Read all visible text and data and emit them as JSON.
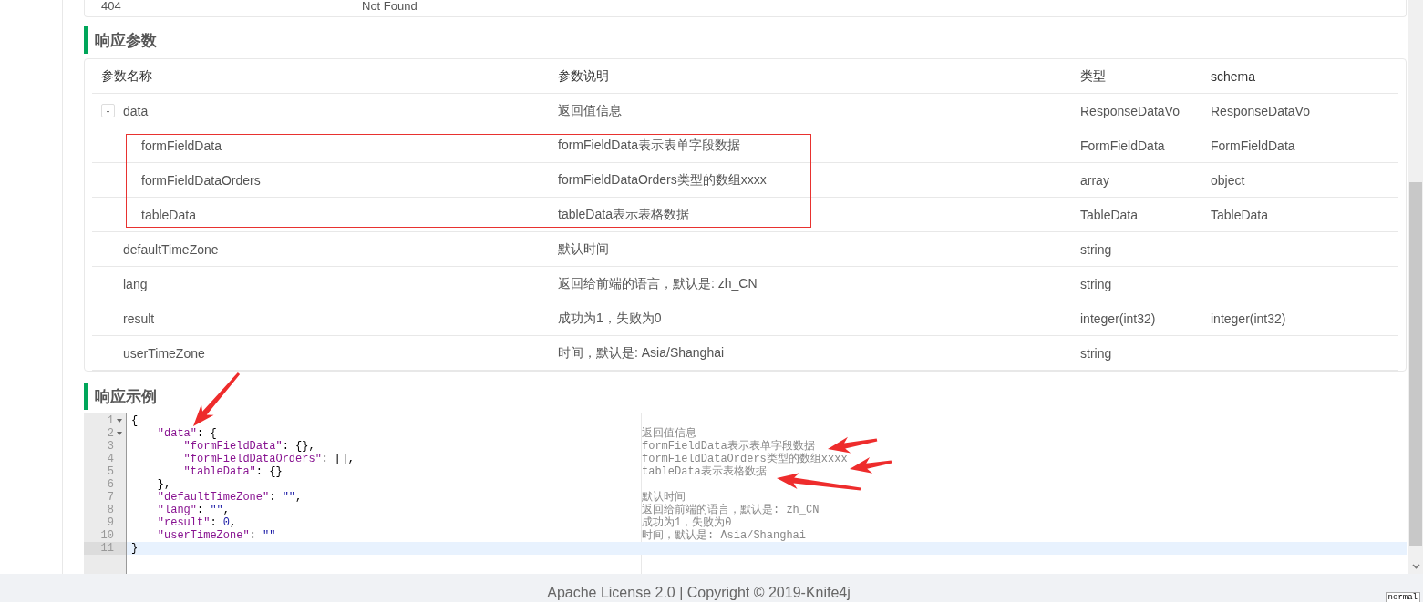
{
  "status_card": {
    "code": "404",
    "message": "Not Found"
  },
  "response_params": {
    "title": "响应参数",
    "columns": [
      "参数名称",
      "参数说明",
      "类型",
      "schema"
    ],
    "rows": [
      {
        "name": "data",
        "description": "返回值信息",
        "type": "ResponseDataVo",
        "schema": "ResponseDataVo",
        "toggle": "-",
        "expanded": true,
        "children": [
          {
            "name": "formFieldData",
            "description": "formFieldData表示表单字段数据",
            "type": "FormFieldData",
            "schema": "FormFieldData"
          },
          {
            "name": "formFieldDataOrders",
            "description": "formFieldDataOrders类型的数组xxxx",
            "type": "array",
            "schema": "object"
          },
          {
            "name": "tableData",
            "description": "tableData表示表格数据",
            "type": "TableData",
            "schema": "TableData"
          }
        ]
      },
      {
        "name": "defaultTimeZone",
        "description": "默认时间",
        "type": "string"
      },
      {
        "name": "lang",
        "description": "返回给前端的语言，默认是: zh_CN",
        "type": "string"
      },
      {
        "name": "result",
        "description": "成功为1，失败为0",
        "type": "integer(int32)",
        "schema": "integer(int32)"
      },
      {
        "name": "userTimeZone",
        "description": "时间，默认是: Asia/Shanghai",
        "type": "string"
      }
    ]
  },
  "response_example": {
    "title": "响应示例",
    "lines": [
      {
        "num": "1",
        "foldable": true,
        "current": false,
        "tokens": [
          {
            "kind": "punct",
            "text": "{"
          }
        ]
      },
      {
        "num": "2",
        "foldable": true,
        "current": false,
        "tokens": [
          {
            "kind": "key",
            "text": "    \"data\""
          },
          {
            "kind": "punct",
            "text": ": {"
          }
        ],
        "comment": "返回值信息"
      },
      {
        "num": "3",
        "foldable": false,
        "current": false,
        "tokens": [
          {
            "kind": "key",
            "text": "        \"formFieldData\""
          },
          {
            "kind": "punct",
            "text": ": {},"
          }
        ],
        "comment": "formFieldData表示表单字段数据"
      },
      {
        "num": "4",
        "foldable": false,
        "current": false,
        "tokens": [
          {
            "kind": "key",
            "text": "        \"formFieldDataOrders\""
          },
          {
            "kind": "punct",
            "text": ": [],"
          }
        ],
        "comment": "formFieldDataOrders类型的数组xxxx"
      },
      {
        "num": "5",
        "foldable": false,
        "current": false,
        "tokens": [
          {
            "kind": "key",
            "text": "        \"tableData\""
          },
          {
            "kind": "punct",
            "text": ": {}"
          }
        ],
        "comment": "tableData表示表格数据"
      },
      {
        "num": "6",
        "foldable": false,
        "current": false,
        "tokens": [
          {
            "kind": "punct",
            "text": "    },"
          }
        ]
      },
      {
        "num": "7",
        "foldable": false,
        "current": false,
        "tokens": [
          {
            "kind": "key",
            "text": "    \"defaultTimeZone\""
          },
          {
            "kind": "punct",
            "text": ": "
          },
          {
            "kind": "string",
            "text": "\"\""
          },
          {
            "kind": "punct",
            "text": ","
          }
        ],
        "comment": "默认时间"
      },
      {
        "num": "8",
        "foldable": false,
        "current": false,
        "tokens": [
          {
            "kind": "key",
            "text": "    \"lang\""
          },
          {
            "kind": "punct",
            "text": ": "
          },
          {
            "kind": "string",
            "text": "\"\""
          },
          {
            "kind": "punct",
            "text": ","
          }
        ],
        "comment": "返回给前端的语言，默认是: zh_CN"
      },
      {
        "num": "9",
        "foldable": false,
        "current": false,
        "tokens": [
          {
            "kind": "key",
            "text": "    \"result\""
          },
          {
            "kind": "punct",
            "text": ": "
          },
          {
            "kind": "number",
            "text": "0"
          },
          {
            "kind": "punct",
            "text": ","
          }
        ],
        "comment": "成功为1，失败为0"
      },
      {
        "num": "10",
        "foldable": false,
        "current": false,
        "tokens": [
          {
            "kind": "key",
            "text": "    \"userTimeZone\""
          },
          {
            "kind": "punct",
            "text": ": "
          },
          {
            "kind": "string",
            "text": "\"\""
          }
        ],
        "comment": "时间，默认是: Asia/Shanghai"
      },
      {
        "num": "11",
        "foldable": false,
        "current": true,
        "tokens": [
          {
            "kind": "punct",
            "text": "}"
          }
        ]
      }
    ]
  },
  "footer": {
    "text": "Apache License 2.0 | Copyright © 2019-Knife4j",
    "badge": "normal"
  }
}
